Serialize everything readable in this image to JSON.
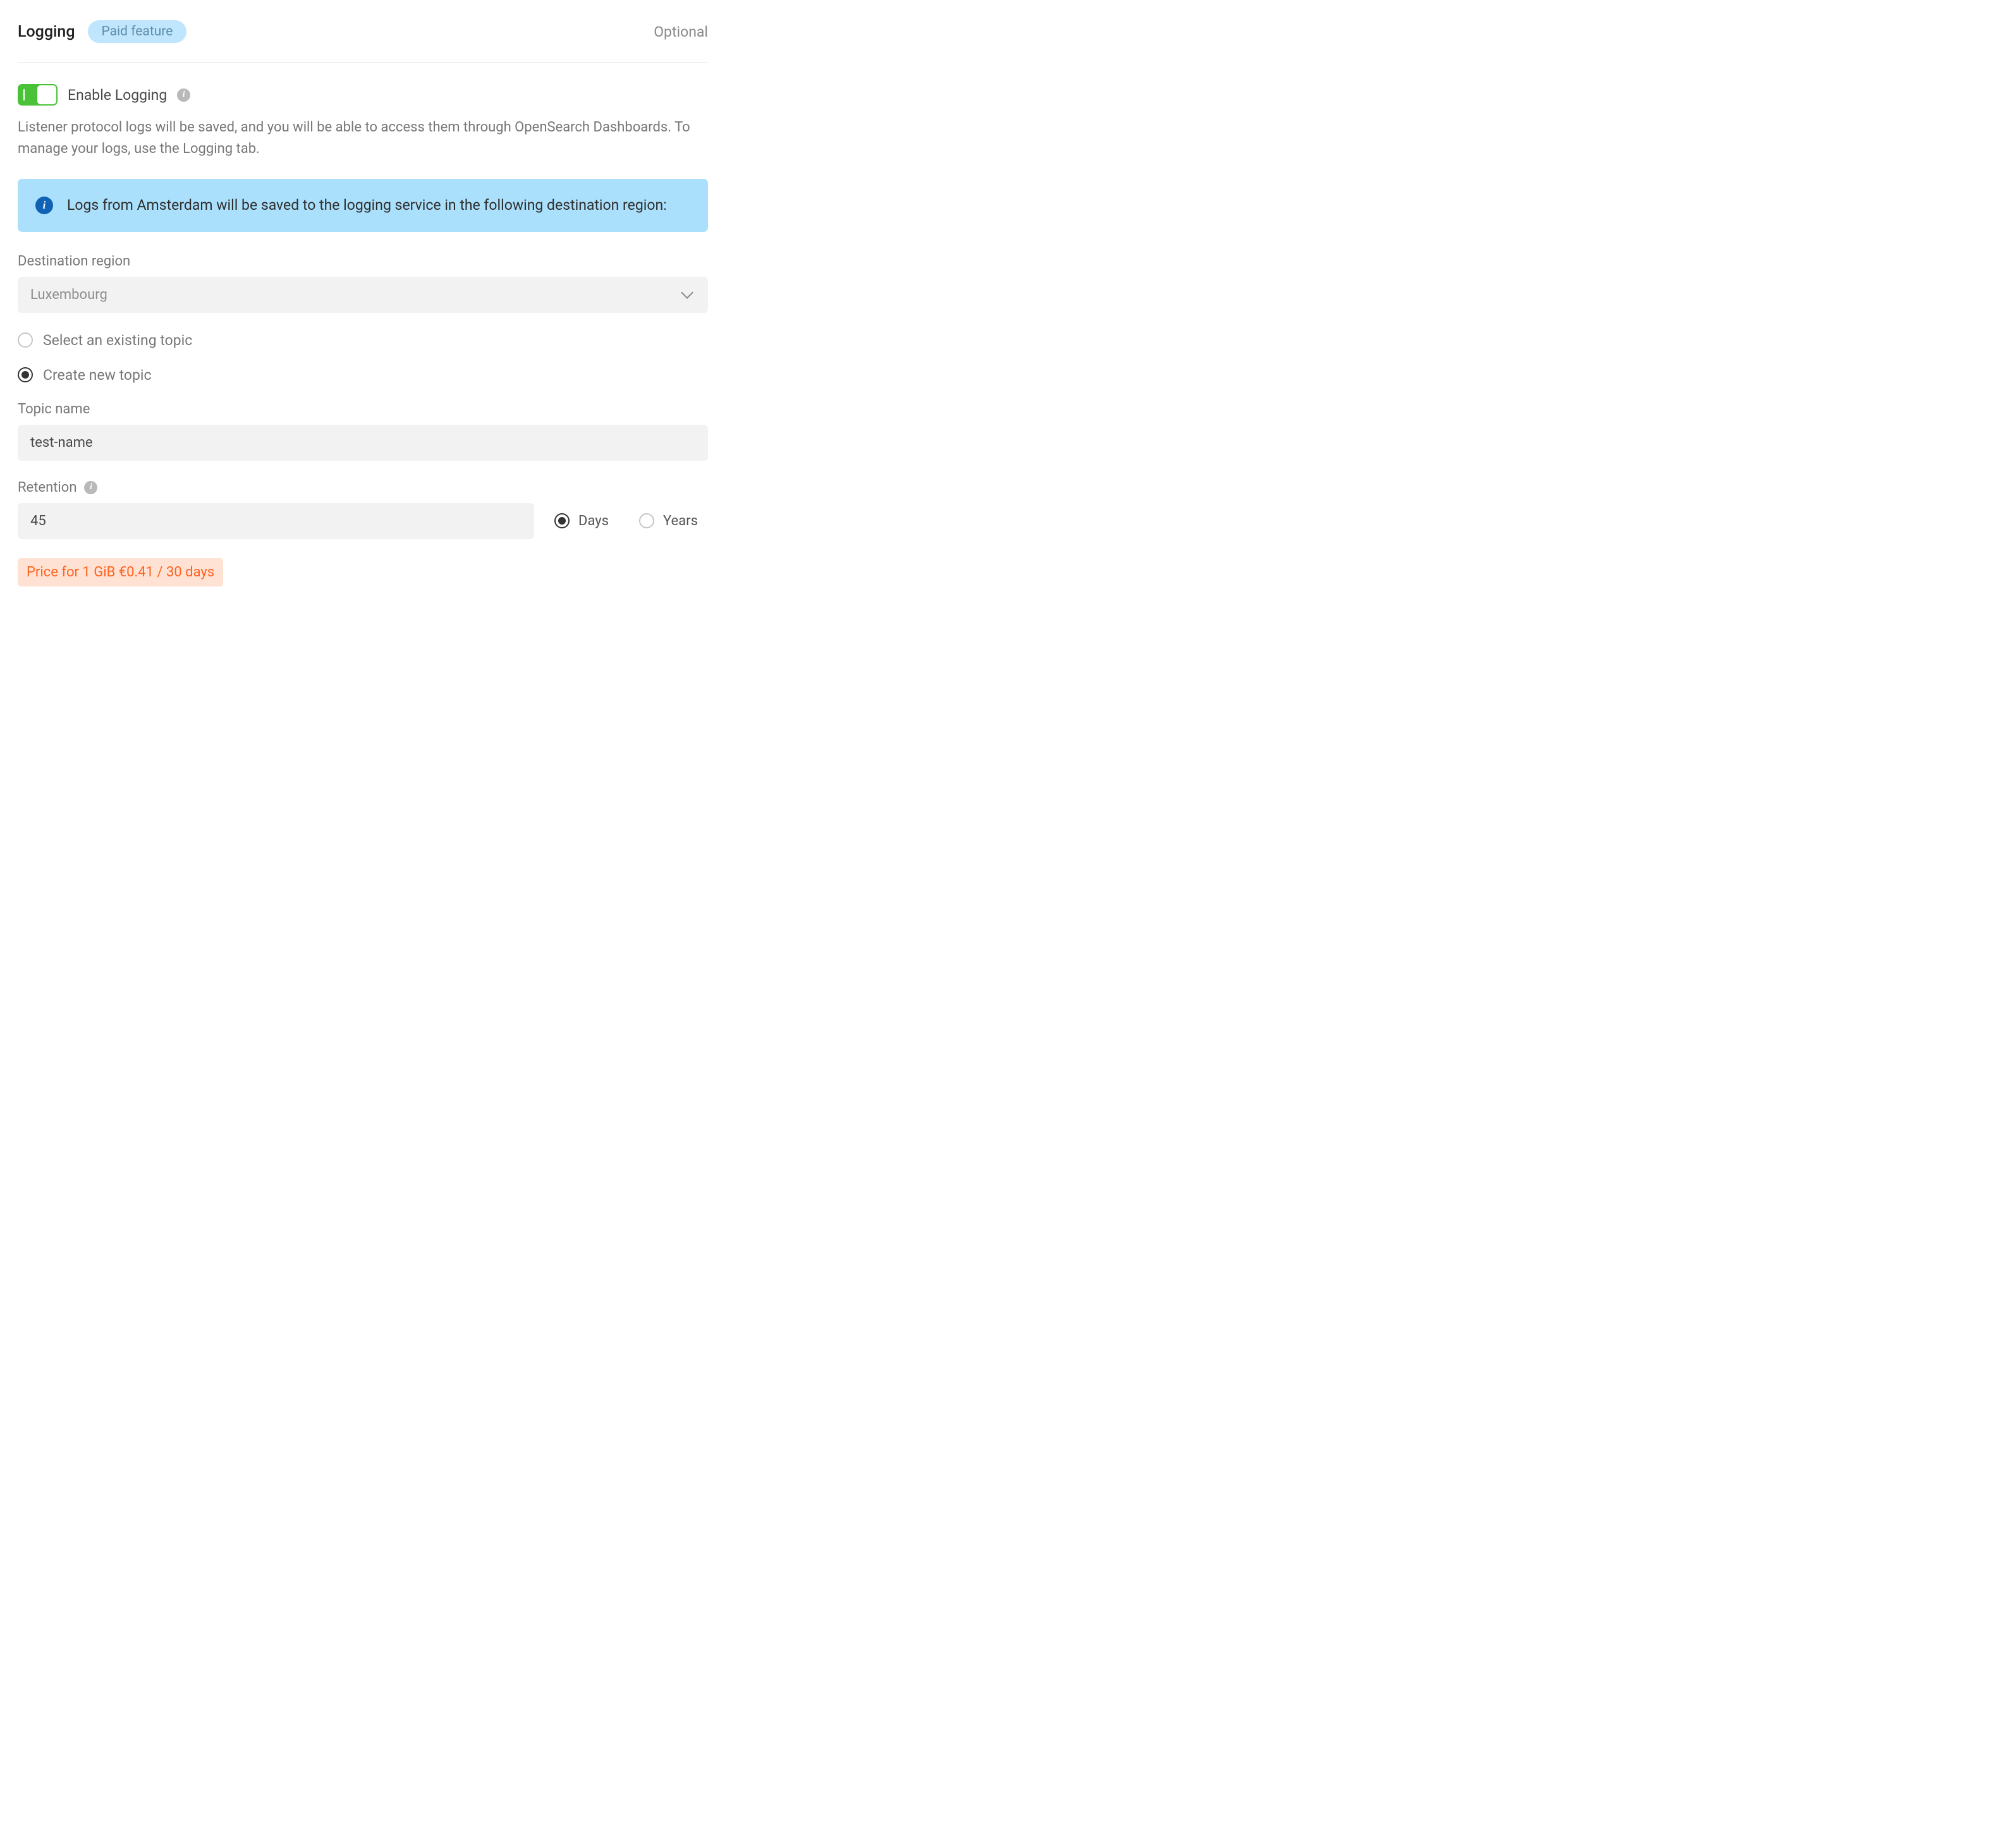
{
  "header": {
    "title": "Logging",
    "badge": "Paid feature",
    "optional": "Optional"
  },
  "toggle": {
    "label": "Enable Logging",
    "enabled": true
  },
  "helper": "Listener protocol logs will be saved, and you will be able to access them through OpenSearch Dashboards. To manage your logs, use the Logging tab.",
  "banner": "Logs from Amsterdam will be saved to the logging service in the following destination region:",
  "destination": {
    "label": "Destination region",
    "value": "Luxembourg"
  },
  "topic_mode": {
    "existing_label": "Select an existing topic",
    "create_label": "Create new topic",
    "selected": "create"
  },
  "topic_name": {
    "label": "Topic name",
    "value": "test-name"
  },
  "retention": {
    "label": "Retention",
    "value": "45",
    "unit_days": "Days",
    "unit_years": "Years",
    "selected_unit": "days"
  },
  "price": "Price for 1 GiB €0.41 / 30 days"
}
